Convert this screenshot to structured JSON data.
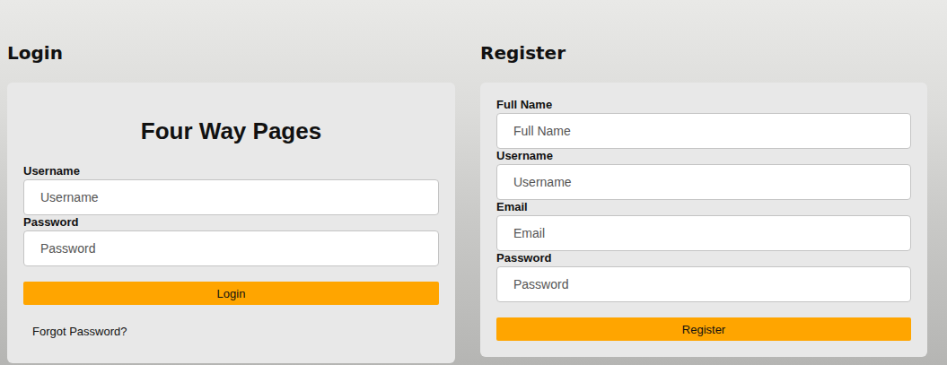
{
  "login": {
    "heading": "Login",
    "title": "Four Way Pages",
    "fields": [
      {
        "label": "Username",
        "placeholder": "Username",
        "kind": "text"
      },
      {
        "label": "Password",
        "placeholder": "Password",
        "kind": "password"
      }
    ],
    "button": "Login",
    "link": "Forgot Password?"
  },
  "register": {
    "heading": "Register",
    "fields": [
      {
        "label": "Full Name",
        "placeholder": "Full Name",
        "kind": "text"
      },
      {
        "label": "Username",
        "placeholder": "Username",
        "kind": "text"
      },
      {
        "label": "Email",
        "placeholder": "Email",
        "kind": "email"
      },
      {
        "label": "Password",
        "placeholder": "Password",
        "kind": "password"
      }
    ],
    "button": "Register"
  }
}
